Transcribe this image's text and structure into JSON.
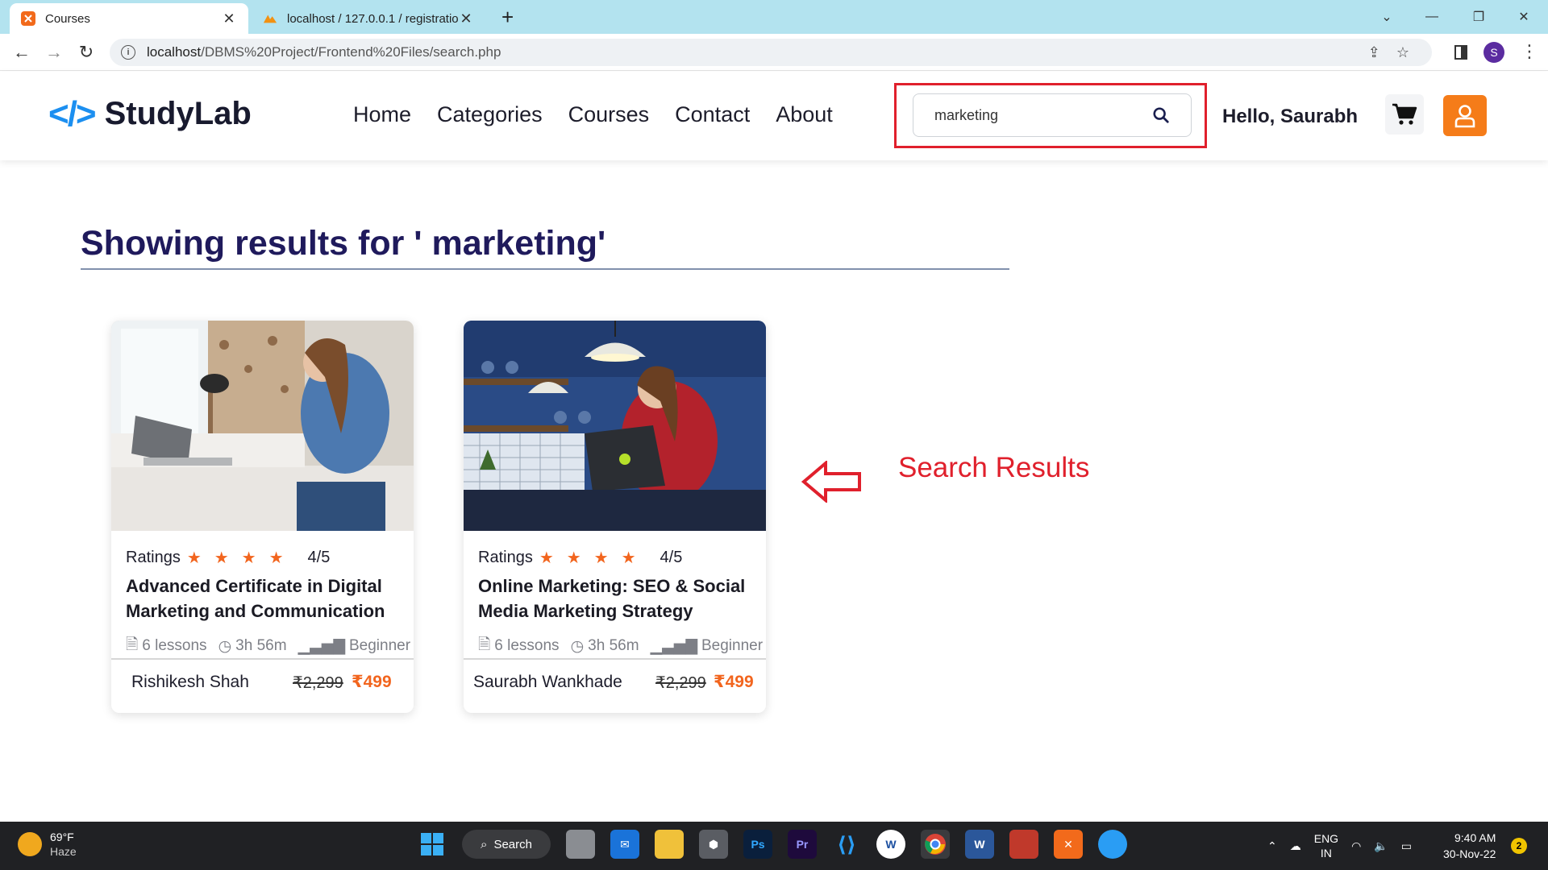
{
  "browser": {
    "tabs": [
      {
        "title": "Courses",
        "active": true
      },
      {
        "title": "localhost / 127.0.0.1 / registration",
        "active": false
      }
    ],
    "url_prefix": "localhost",
    "url_path": "/DBMS%20Project/Frontend%20Files/search.php",
    "profile_initial": "S"
  },
  "site": {
    "logo_mark": "</>",
    "logo_name": "StudyLab",
    "nav": [
      "Home",
      "Categories",
      "Courses",
      "Contact",
      "About"
    ],
    "search": {
      "value": "marketing"
    },
    "greeting": "Hello, Saurabh",
    "accent_color": "#f57c19",
    "brand_color": "#1c8ff0"
  },
  "results": {
    "heading": "Showing results for ' marketing'"
  },
  "courses": [
    {
      "ratings_label": "Ratings",
      "rating_text": "4/5",
      "stars": 4,
      "title": "Advanced Certificate in Digital Marketing and Communication",
      "lessons": "6 lessons",
      "duration": "3h 56m",
      "level": "Beginner",
      "instructor": "Rishikesh Shah",
      "old_price": "₹2,299",
      "price": "₹499"
    },
    {
      "ratings_label": "Ratings",
      "rating_text": "4/5",
      "stars": 4,
      "title": "Online Marketing: SEO & Social Media Marketing Strategy",
      "lessons": "6 lessons",
      "duration": "3h 56m",
      "level": "Beginner",
      "instructor": "Saurabh Wankhade",
      "old_price": "₹2,299",
      "price": "₹499"
    }
  ],
  "annotation": {
    "text": "Search Results",
    "color": "#e0202c"
  },
  "taskbar": {
    "weather_temp": "69°F",
    "weather_desc": "Haze",
    "search_label": "Search",
    "lang_1": "ENG",
    "lang_2": "IN",
    "time": "9:40 AM",
    "date": "30-Nov-22",
    "notifications": "2"
  }
}
